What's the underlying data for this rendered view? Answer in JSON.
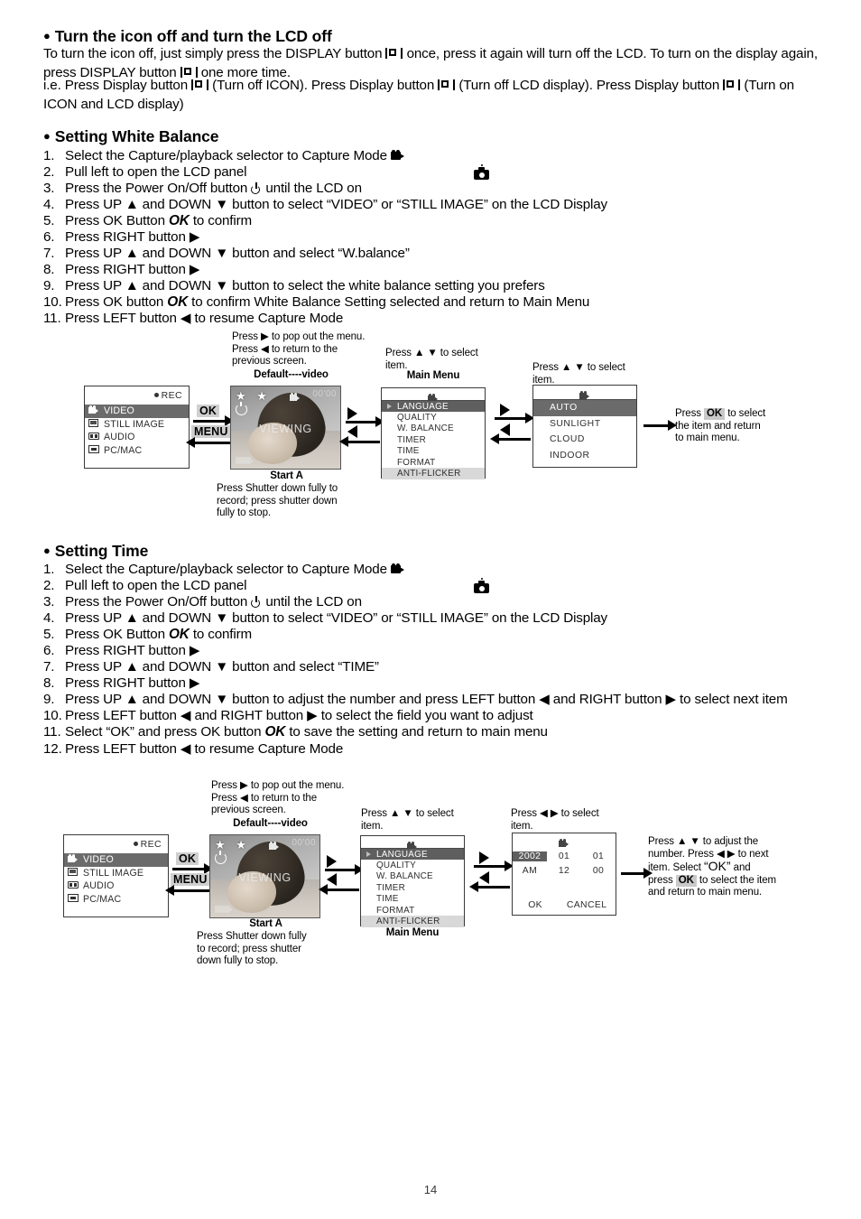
{
  "section1": {
    "heading": "Turn the icon off and turn the LCD off",
    "p1_a": "To turn the icon off, just simply press the DISPLAY button",
    "p1_b": "once, press it again will turn off the LCD. To turn on the display again, press DISPLAY button",
    "p1_c": "one more time.",
    "p2_a": "i.e. Press Display button",
    "p2_b": "(Turn off ICON).  Press Display button",
    "p2_c": "(Turn off LCD display).  Press Display button",
    "p2_d": "(Turn on ICON and LCD display)"
  },
  "section2": {
    "heading": "Setting White Balance",
    "items": [
      {
        "num": "1.",
        "text": "Select the Capture/playback selector to Capture Mode"
      },
      {
        "num": "2.",
        "text": "Pull left to open the LCD panel"
      },
      {
        "num": "3.",
        "text": "Press the Power On/Off button"
      },
      {
        "num": "3b",
        "text": "until the LCD on"
      },
      {
        "num": "4.",
        "text": "Press UP ▲ and DOWN ▼ button to select “VIDEO” or “STILL IMAGE” on the LCD Display"
      },
      {
        "num": "5.",
        "text": "Press OK Button"
      },
      {
        "num": "5b",
        "text": "to confirm"
      },
      {
        "num": "6.",
        "text": "Press RIGHT button ▶"
      },
      {
        "num": "7.",
        "text": "Press UP ▲ and DOWN ▼ button and select “W.balance”"
      },
      {
        "num": "8.",
        "text": "Press RIGHT button ▶"
      },
      {
        "num": "9.",
        "text": "Press UP ▲ and DOWN ▼ button to select the white balance setting you prefers"
      },
      {
        "num": "10.",
        "text": "Press OK button"
      },
      {
        "num": "10b",
        "text": "to confirm White Balance Setting selected and return to Main Menu"
      },
      {
        "num": "11.",
        "text": "Press LEFT button ◀ to resume Capture Mode"
      }
    ],
    "ok_label": "OK"
  },
  "section3": {
    "heading": "Setting Time",
    "items": [
      {
        "num": "1.",
        "text": "Select the Capture/playback selector to Capture Mode"
      },
      {
        "num": "2.",
        "text": "Pull left to open the LCD panel"
      },
      {
        "num": "3.",
        "text": "Press the Power On/Off button"
      },
      {
        "num": "3b",
        "text": "until the LCD on"
      },
      {
        "num": "4.",
        "text": "Press UP ▲ and DOWN ▼ button to select “VIDEO” or “STILL IMAGE” on the LCD Display"
      },
      {
        "num": "5.",
        "text": "Press OK Button"
      },
      {
        "num": "5b",
        "text": "to confirm"
      },
      {
        "num": "6.",
        "text": "Press RIGHT button ▶"
      },
      {
        "num": "7.",
        "text": "Press UP ▲ and DOWN ▼ button and select “TIME”"
      },
      {
        "num": "8.",
        "text": "Press RIGHT button ▶"
      },
      {
        "num": "9.",
        "text": "Press UP ▲ and DOWN ▼ button to adjust the number and press LEFT button ◀ and RIGHT button ▶ to select next item"
      },
      {
        "num": "10.",
        "text": "Press LEFT button ◀ and RIGHT button ▶ to select the field you want to adjust"
      },
      {
        "num": "11a",
        "text": "Select “OK” and press OK button"
      },
      {
        "num": "11b",
        "text": "to save the setting and return to main menu"
      },
      {
        "num": "12.",
        "text": "Press LEFT button ◀ to resume Capture Mode"
      }
    ]
  },
  "diagram1": {
    "note_popout_l1": "Press ▶ to pop out the menu.",
    "note_popout_l2": "Press ◀ to return to the",
    "note_popout_l3": "previous screen.",
    "default_label": "Default----video",
    "note_select_l1": "Press ▲ ▼ to select",
    "note_select_l2": "item.",
    "main_menu_label": "Main Menu",
    "note_select2_l1": "Press ▲ ▼ to select",
    "note_select2_l2": "item.",
    "note_ok_l1a": "Press",
    "note_ok_chip": "OK",
    "note_ok_l1b": "to select",
    "note_ok_l2": "the item and return",
    "note_ok_l3": "to main menu.",
    "start_label": "Start A",
    "start_note_l1": "Press Shutter down fully to",
    "start_note_l2": "record; press shutter down",
    "start_note_l3": "fully to stop.",
    "mode_panel": {
      "rec_label": "REC",
      "items": [
        {
          "label": "VIDEO",
          "icon": "video-icon",
          "selected": true
        },
        {
          "label": "STILL IMAGE",
          "icon": "still-image-icon",
          "selected": false
        },
        {
          "label": "AUDIO",
          "icon": "audio-icon",
          "selected": false
        },
        {
          "label": "PC/MAC",
          "icon": "pc-mac-icon",
          "selected": false
        }
      ]
    },
    "keys": {
      "ok": "OK",
      "menu": "MENU"
    },
    "preview": {
      "stars": "★ ★",
      "timecode": "00'00",
      "viewing": "VIEWING"
    },
    "menu_panel": {
      "items": [
        {
          "label": "LANGUAGE",
          "state": "selected"
        },
        {
          "label": "QUALITY",
          "state": "normal"
        },
        {
          "label": "W. BALANCE",
          "state": "normal"
        },
        {
          "label": "TIMER",
          "state": "normal"
        },
        {
          "label": "TIME",
          "state": "normal"
        },
        {
          "label": "FORMAT",
          "state": "normal"
        },
        {
          "label": "ANTI-FLICKER",
          "state": "gray"
        }
      ]
    },
    "wb_panel": {
      "items": [
        {
          "label": "AUTO",
          "selected": true
        },
        {
          "label": "SUNLIGHT",
          "selected": false
        },
        {
          "label": "CLOUD",
          "selected": false
        },
        {
          "label": "INDOOR",
          "selected": false
        }
      ]
    }
  },
  "diagram2": {
    "note_popout_l1": "Press ▶ to pop out the menu.",
    "note_popout_l2": "Press ◀ to return to the",
    "note_popout_l3": "previous screen.",
    "default_label": "Default----video",
    "note_select_l1": "Press ▲ ▼ to select",
    "note_select_l2": "item.",
    "main_menu_label": "Main Menu",
    "note_select2_l1": "Press ◀ ▶ to select",
    "note_select2_l2": "item.",
    "start_label": "Start A",
    "start_note_l1": "Press Shutter down fully",
    "start_note_l2": "to record; press shutter",
    "start_note_l3": "down fully to stop.",
    "note_adjust_l1": "Press ▲ ▼ to adjust the",
    "note_adjust_l2": "number. Press ◀ ▶ to next",
    "note_adjust_l3a": "item. Select",
    "note_adjust_l3b": "“OK”",
    "note_adjust_l3c": "and",
    "note_adjust_l4a": "press",
    "note_adjust_chip": "OK",
    "note_adjust_l4b": "to select the item",
    "note_adjust_l5": "and return to main menu.",
    "mode_panel": {
      "rec_label": "REC",
      "items": [
        {
          "label": "VIDEO",
          "icon": "video-icon",
          "selected": true
        },
        {
          "label": "STILL IMAGE",
          "icon": "still-image-icon",
          "selected": false
        },
        {
          "label": "AUDIO",
          "icon": "audio-icon",
          "selected": false
        },
        {
          "label": "PC/MAC",
          "icon": "pc-mac-icon",
          "selected": false
        }
      ]
    },
    "keys": {
      "ok": "OK",
      "menu": "MENU"
    },
    "preview": {
      "stars": "★ ★",
      "timecode": "00'00",
      "viewing": "VIEWING"
    },
    "menu_panel": {
      "items": [
        {
          "label": "LANGUAGE",
          "state": "selected"
        },
        {
          "label": "QUALITY",
          "state": "normal"
        },
        {
          "label": "W. BALANCE",
          "state": "normal"
        },
        {
          "label": "TIMER",
          "state": "normal"
        },
        {
          "label": "TIME",
          "state": "normal"
        },
        {
          "label": "FORMAT",
          "state": "normal"
        },
        {
          "label": "ANTI-FLICKER",
          "state": "gray"
        }
      ]
    },
    "time_panel": {
      "row1": [
        {
          "v": "2002",
          "hl": true
        },
        {
          "v": "01",
          "hl": false
        },
        {
          "v": "01",
          "hl": false
        }
      ],
      "row2": [
        {
          "v": "AM",
          "hl": false
        },
        {
          "v": "12",
          "hl": false
        },
        {
          "v": "00",
          "hl": false
        }
      ],
      "ok": "OK",
      "cancel": "CANCEL"
    }
  },
  "footer": {
    "page_number": "14"
  }
}
